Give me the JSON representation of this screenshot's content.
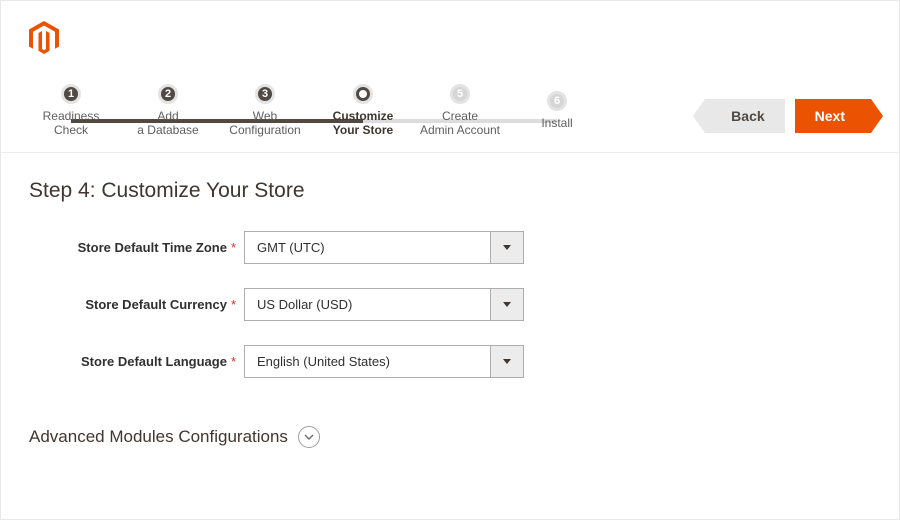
{
  "colors": {
    "accent": "#eb5202",
    "dark": "#514943"
  },
  "nav": {
    "back": "Back",
    "next": "Next"
  },
  "steps": [
    {
      "num": "1",
      "label": "Readiness\nCheck",
      "state": "done"
    },
    {
      "num": "2",
      "label": "Add\na Database",
      "state": "done"
    },
    {
      "num": "3",
      "label": "Web\nConfiguration",
      "state": "done"
    },
    {
      "num": "",
      "label": "Customize\nYour Store",
      "state": "current"
    },
    {
      "num": "5",
      "label": "Create\nAdmin Account",
      "state": "todo"
    },
    {
      "num": "6",
      "label": "Install",
      "state": "todo"
    }
  ],
  "title": "Step 4: Customize Your Store",
  "form": {
    "timezone": {
      "label": "Store Default Time Zone",
      "value": "GMT (UTC)"
    },
    "currency": {
      "label": "Store Default Currency",
      "value": "US Dollar (USD)"
    },
    "language": {
      "label": "Store Default Language",
      "value": "English (United States)"
    }
  },
  "advanced_heading": "Advanced Modules Configurations"
}
